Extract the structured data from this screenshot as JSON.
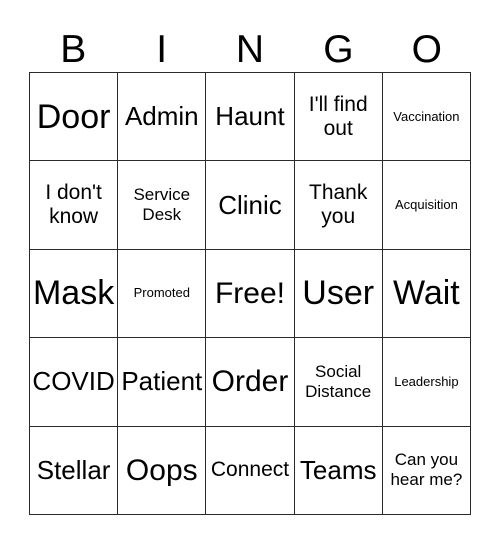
{
  "card": {
    "title": "BINGO",
    "background_color": "#ffffff",
    "text_color": "#000000",
    "border_color": "#2b2b2b"
  },
  "header": {
    "letters": [
      {
        "label": "B"
      },
      {
        "label": "I"
      },
      {
        "label": "N"
      },
      {
        "label": "G"
      },
      {
        "label": "O"
      }
    ]
  },
  "grid": {
    "rows": 5,
    "columns": 5,
    "cells": [
      [
        {
          "label": "Door",
          "size": "sz-xl"
        },
        {
          "label": "Admin",
          "size": "sz-md"
        },
        {
          "label": "Haunt",
          "size": "sz-md"
        },
        {
          "label": "I'll find out",
          "size": "sz-sm"
        },
        {
          "label": "Vaccination",
          "size": "sz-xxs"
        }
      ],
      [
        {
          "label": "I don't know",
          "size": "sz-sm"
        },
        {
          "label": "Service Desk",
          "size": "sz-xs"
        },
        {
          "label": "Clinic",
          "size": "sz-md"
        },
        {
          "label": "Thank you",
          "size": "sz-sm"
        },
        {
          "label": "Acquisition",
          "size": "sz-xxs"
        }
      ],
      [
        {
          "label": "Mask",
          "size": "sz-xl"
        },
        {
          "label": "Promoted",
          "size": "sz-xxs"
        },
        {
          "label": "Free!",
          "size": "sz-lg"
        },
        {
          "label": "User",
          "size": "sz-xl"
        },
        {
          "label": "Wait",
          "size": "sz-xl"
        }
      ],
      [
        {
          "label": "COVID",
          "size": "sz-md"
        },
        {
          "label": "Patient",
          "size": "sz-md"
        },
        {
          "label": "Order",
          "size": "sz-lg"
        },
        {
          "label": "Social Distance",
          "size": "sz-xs"
        },
        {
          "label": "Leadership",
          "size": "sz-xxs"
        }
      ],
      [
        {
          "label": "Stellar",
          "size": "sz-md"
        },
        {
          "label": "Oops",
          "size": "sz-lg"
        },
        {
          "label": "Connect",
          "size": "sz-sm"
        },
        {
          "label": "Teams",
          "size": "sz-md"
        },
        {
          "label": "Can you hear me?",
          "size": "sz-xs"
        }
      ]
    ]
  }
}
